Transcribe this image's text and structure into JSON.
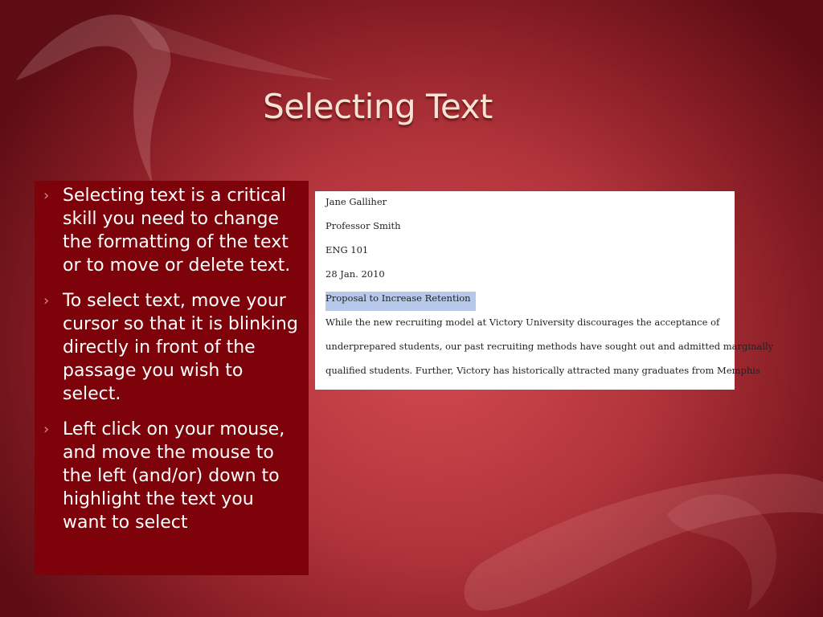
{
  "slide": {
    "title": "Selecting Text",
    "bullets": [
      "Selecting text is a critical skill you need to change the formatting of the text or to move or delete text.",
      "To select text, move your cursor so that it is blinking directly in front of the passage you wish to select.",
      "Left click on your mouse, and move the mouse to the left (and/or) down to highlight the text you want to select"
    ],
    "bullet_icon": "chevron-right-icon"
  },
  "document": {
    "lines": [
      "Jane Galliher",
      "Professor Smith",
      "ENG 101",
      "28 Jan. 2010",
      "Proposal to Increase Retention",
      "While the new recruiting model at Victory University discourages the acceptance of",
      "underprepared students, our past recruiting methods have sought out and admitted marginally",
      "qualified students.  Further, Victory has historically attracted many graduates from Memphis"
    ],
    "highlighted_line_index": 4
  },
  "colors": {
    "background": "#b2343b",
    "panel": "#7d0209",
    "title": "#f6e3d6",
    "selection_highlight": "#b7c9ea"
  }
}
